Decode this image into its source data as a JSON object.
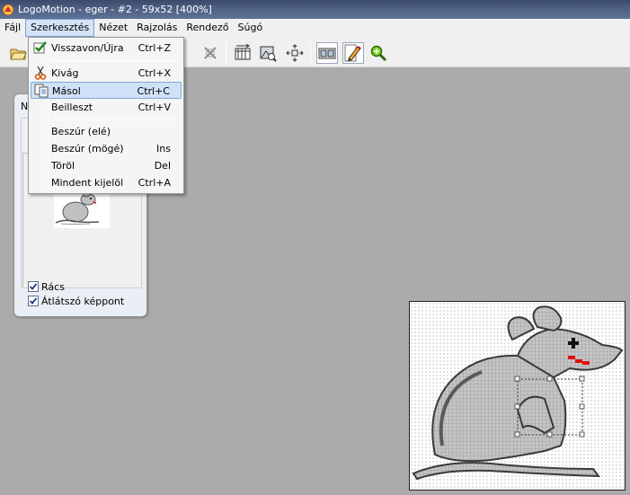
{
  "window": {
    "title": "LogoMotion - eger - #2 - 59x52 [400%]"
  },
  "menubar": {
    "items": [
      "Fájl",
      "Szerkesztés",
      "Nézet",
      "Rajzolás",
      "Rendező",
      "Súgó"
    ],
    "open_index": 1
  },
  "toolbar": {
    "buttons": [
      {
        "icon": "open-folder-icon"
      },
      {
        "icon": "delete-x-icon"
      },
      {
        "icon": "animation-timeline-icon"
      },
      {
        "icon": "image-preview-icon"
      },
      {
        "icon": "center-arrows-icon"
      },
      {
        "icon": "film-icon"
      },
      {
        "icon": "pencil-icon"
      },
      {
        "icon": "zoom-icon"
      }
    ]
  },
  "edit_menu": {
    "items": [
      {
        "label": "Visszavon/Újra",
        "shortcut": "Ctrl+Z",
        "icon": "undo-check-icon"
      },
      {
        "label": "Kivág",
        "shortcut": "Ctrl+X",
        "icon": "scissors-icon"
      },
      {
        "label": "Másol",
        "shortcut": "Ctrl+C",
        "icon": "copy-icon",
        "highlighted": true
      },
      {
        "label": "Beilleszt",
        "shortcut": "Ctrl+V"
      },
      {
        "label": "Beszúr (elé)",
        "shortcut": ""
      },
      {
        "label": "Beszúr (mögé)",
        "shortcut": "Ins"
      },
      {
        "label": "Töröl",
        "shortcut": "Del"
      },
      {
        "label": "Mindent kijelöl",
        "shortcut": "Ctrl+A"
      }
    ]
  },
  "panel": {
    "title": "N",
    "checkboxes": [
      {
        "label": "Rács",
        "checked": true
      },
      {
        "label": "Átlátszó képpont",
        "checked": true
      }
    ]
  },
  "colors": {
    "title_bar": "#4c5e82",
    "workspace": "#ababab",
    "menu_highlight": "#cfe1f7",
    "mouse_gray": "#c0c0c0",
    "mouse_outline": "#404040",
    "mouth_red": "#e01010"
  }
}
